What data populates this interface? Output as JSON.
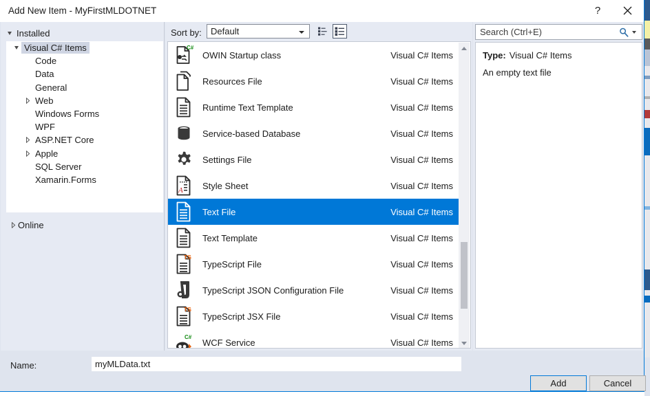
{
  "window": {
    "title": "Add New Item - MyFirstMLDOTNET",
    "help_icon": "question-mark-icon",
    "close_icon": "close-icon"
  },
  "left_panel": {
    "header_label": "Installed",
    "tree": [
      {
        "label": "Visual C# Items",
        "indent": 0,
        "twisty": "expanded",
        "selected": true
      },
      {
        "label": "Code",
        "indent": 1,
        "twisty": "none",
        "selected": false
      },
      {
        "label": "Data",
        "indent": 1,
        "twisty": "none",
        "selected": false
      },
      {
        "label": "General",
        "indent": 1,
        "twisty": "none",
        "selected": false
      },
      {
        "label": "Web",
        "indent": 1,
        "twisty": "collapsed",
        "selected": false
      },
      {
        "label": "Windows Forms",
        "indent": 1,
        "twisty": "none",
        "selected": false
      },
      {
        "label": "WPF",
        "indent": 1,
        "twisty": "none",
        "selected": false
      },
      {
        "label": "ASP.NET Core",
        "indent": 1,
        "twisty": "collapsed",
        "selected": false
      },
      {
        "label": "Apple",
        "indent": 1,
        "twisty": "collapsed",
        "selected": false
      },
      {
        "label": "SQL Server",
        "indent": 1,
        "twisty": "none",
        "selected": false
      },
      {
        "label": "Xamarin.Forms",
        "indent": 1,
        "twisty": "none",
        "selected": false
      }
    ],
    "online_label": "Online",
    "online_twisty": "collapsed"
  },
  "center_panel": {
    "sort_by_label": "Sort by:",
    "sort_by_value": "Default",
    "view_small_icons_icon": "small-icons-view-icon",
    "view_list_icon": "list-view-icon",
    "view_list_selected": true,
    "items": [
      {
        "name": "OWIN Startup class",
        "category": "Visual C# Items",
        "icon": "owin-startup-class-icon",
        "selected": false
      },
      {
        "name": "Resources File",
        "category": "Visual C# Items",
        "icon": "resources-file-icon",
        "selected": false
      },
      {
        "name": "Runtime Text Template",
        "category": "Visual C# Items",
        "icon": "text-document-icon",
        "selected": false
      },
      {
        "name": "Service-based Database",
        "category": "Visual C# Items",
        "icon": "database-icon",
        "selected": false
      },
      {
        "name": "Settings File",
        "category": "Visual C# Items",
        "icon": "gear-icon",
        "selected": false
      },
      {
        "name": "Style Sheet",
        "category": "Visual C# Items",
        "icon": "style-sheet-icon",
        "selected": false
      },
      {
        "name": "Text File",
        "category": "Visual C# Items",
        "icon": "text-document-icon",
        "selected": true
      },
      {
        "name": "Text Template",
        "category": "Visual C# Items",
        "icon": "text-document-icon",
        "selected": false
      },
      {
        "name": "TypeScript File",
        "category": "Visual C# Items",
        "icon": "typescript-file-icon",
        "selected": false
      },
      {
        "name": "TypeScript JSON Configuration File",
        "category": "Visual C# Items",
        "icon": "typescript-json-config-icon",
        "selected": false
      },
      {
        "name": "TypeScript JSX File",
        "category": "Visual C# Items",
        "icon": "typescript-file-icon",
        "selected": false
      },
      {
        "name": "WCF Service",
        "category": "Visual C# Items",
        "icon": "wcf-service-icon",
        "selected": false
      }
    ],
    "scrollbar": {
      "up_arrow_icon": "scroll-up-arrow-icon",
      "down_arrow_icon": "scroll-down-arrow-icon"
    }
  },
  "right_panel": {
    "search_placeholder": "Search (Ctrl+E)",
    "search_value": "",
    "search_icon": "search-icon",
    "details_type_label": "Type:",
    "details_type_value": "Visual C# Items",
    "details_description": "An empty text file"
  },
  "footer": {
    "name_label": "Name:",
    "name_value": "myMLData.txt",
    "add_label": "Add",
    "cancel_label": "Cancel"
  },
  "colors": {
    "accent": "#0078d7",
    "dialog_bg": "#dfe4ee",
    "panel_bg": "#e6eaf3",
    "selection": "#0078d7",
    "typescript_orange": "#e8600a",
    "csharp_green": "#128a12",
    "stylesheet_red": "#c3272b"
  }
}
